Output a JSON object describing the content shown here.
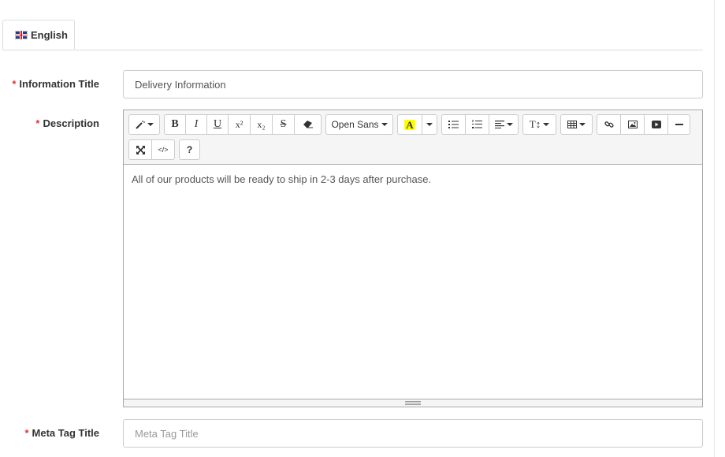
{
  "tabs": [
    {
      "label": "English",
      "icon": "uk-flag-icon"
    }
  ],
  "form": {
    "required_marker": "*",
    "information_title": {
      "label": "Information Title",
      "value": "Delivery Information"
    },
    "description": {
      "label": "Description",
      "content": "All of our products will be ready to ship in 2-3 days after purchase."
    },
    "meta_tag_title": {
      "label": "Meta Tag Title",
      "value": "",
      "placeholder": "Meta Tag Title"
    }
  },
  "toolbar": {
    "style_icon": "magic-wand-icon",
    "bold": "B",
    "italic": "I",
    "underline": "U",
    "superscript": "x²",
    "subscript": "x₂",
    "strikethrough": "S",
    "eraser_icon": "eraser-icon",
    "font_name": "Open Sans",
    "color_letter": "A",
    "highlight_color": "#ffff00",
    "ul_icon": "unordered-list-icon",
    "ol_icon": "ordered-list-icon",
    "align_icon": "align-left-icon",
    "height_label": "T↕",
    "table_icon": "table-icon",
    "link_icon": "link-icon",
    "picture_icon": "picture-icon",
    "video_icon": "video-icon",
    "hr_icon": "horizontal-rule-icon",
    "fullscreen_icon": "fullscreen-icon",
    "codeview_label": "</>",
    "help_label": "?"
  }
}
